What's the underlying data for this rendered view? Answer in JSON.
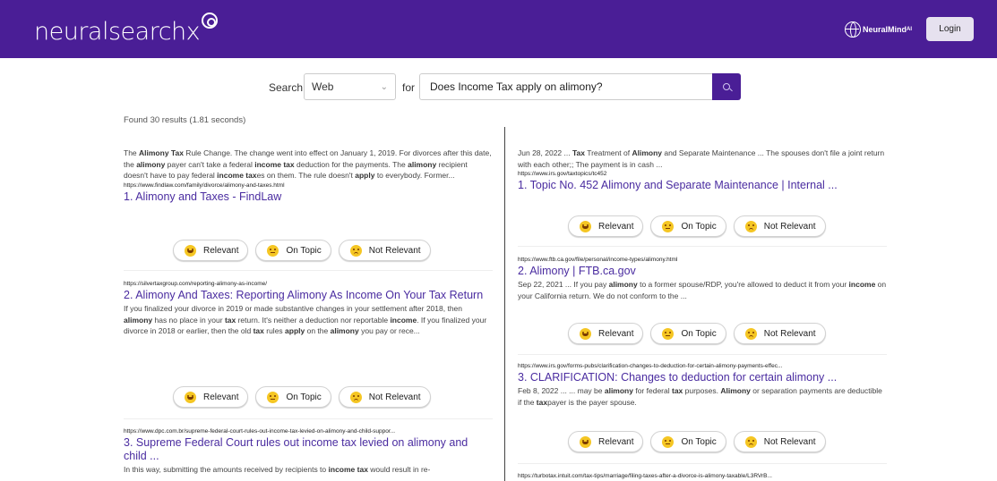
{
  "header": {
    "logo_text": "neuralsearchx",
    "brand_text": "NeuralMind",
    "brand_suffix": "AI",
    "login_label": "Login",
    "background": "#4a1e96"
  },
  "search": {
    "search_label": "Search",
    "source_value": "Web",
    "for_label": "for",
    "query": "Does Income Tax apply on alimony?"
  },
  "results_summary": "Found 30 results (1.81 seconds)",
  "feedback": {
    "relevant": "Relevant",
    "on_topic": "On Topic",
    "not_relevant": "Not Relevant"
  },
  "left_results": [
    {
      "snippet_html": "The <b>Alimony Tax</b> Rule Change. The change went into effect on January 1, 2019. For divorces after this date, the <b>alimony</b> payer can't take a federal <b>income tax</b> deduction for the payments. The <b>alimony</b> recipient doesn't have to pay federal <b>income tax</b>es on them. The rule doesn't <b>apply</b> to everybody. Former...",
      "url": "https://www.findlaw.com/family/divorce/alimony-and-taxes.html",
      "title": "1. Alimony and Taxes - FindLaw"
    },
    {
      "url": "https://silvertaxgroup.com/reporting-alimony-as-income/",
      "title": "2. Alimony And Taxes: Reporting Alimony As Income On Your Tax Return",
      "snippet_html": "If you finalized your divorce in 2019 or made substantive changes in your settlement after 2018, then <b>alimony</b> has no place in your <b>tax</b> return. It's neither a deduction nor reportable <b>income</b>. If you finalized your divorce in 2018 or earlier, then the old <b>tax</b> rules <b>apply</b> on the <b>alimony</b> you pay or rece..."
    },
    {
      "url": "https://www.dpc.com.br/supreme-federal-court-rules-out-income-tax-levied-on-alimony-and-child-suppor...",
      "title": "3. Supreme Federal Court rules out income tax levied on alimony and child ...",
      "snippet_html": "In this way, submitting the amounts received by recipients to <b>income tax</b> would result in re-"
    }
  ],
  "right_results": [
    {
      "snippet_html": "Jun 28, 2022 ... <b>Tax</b> Treatment of <b>Alimony</b> and Separate Maintenance ... The spouses don't file a joint return with each other;; The payment is in cash ...",
      "url": "https://www.irs.gov/taxtopics/tc452",
      "title": "1. Topic No. 452 Alimony and Separate Maintenance | Internal ..."
    },
    {
      "url": "https://www.ftb.ca.gov/file/personal/income-types/alimony.html",
      "title": "2. Alimony | FTB.ca.gov",
      "snippet_html": "Sep 22, 2021 ... If you pay <b>alimony</b> to a former spouse/RDP, you're allowed to deduct it from your <b>income</b> on your California return. We do not conform to the ..."
    },
    {
      "url": "https://www.irs.gov/forms-pubs/clarification-changes-to-deduction-for-certain-alimony-payments-effec...",
      "title": "3. CLARIFICATION: Changes to deduction for certain alimony ...",
      "snippet_html": "Feb 8, 2022 ... ... may be <b>alimony</b> for federal <b>tax</b> purposes. <b>Alimony</b> or separation payments are deductible if the <b>tax</b>payer is the payer spouse."
    },
    {
      "url": "https://turbotax.intuit.com/tax-tips/marriage/filing-taxes-after-a-divorce-is-alimony-taxable/L3RVrB..."
    }
  ]
}
